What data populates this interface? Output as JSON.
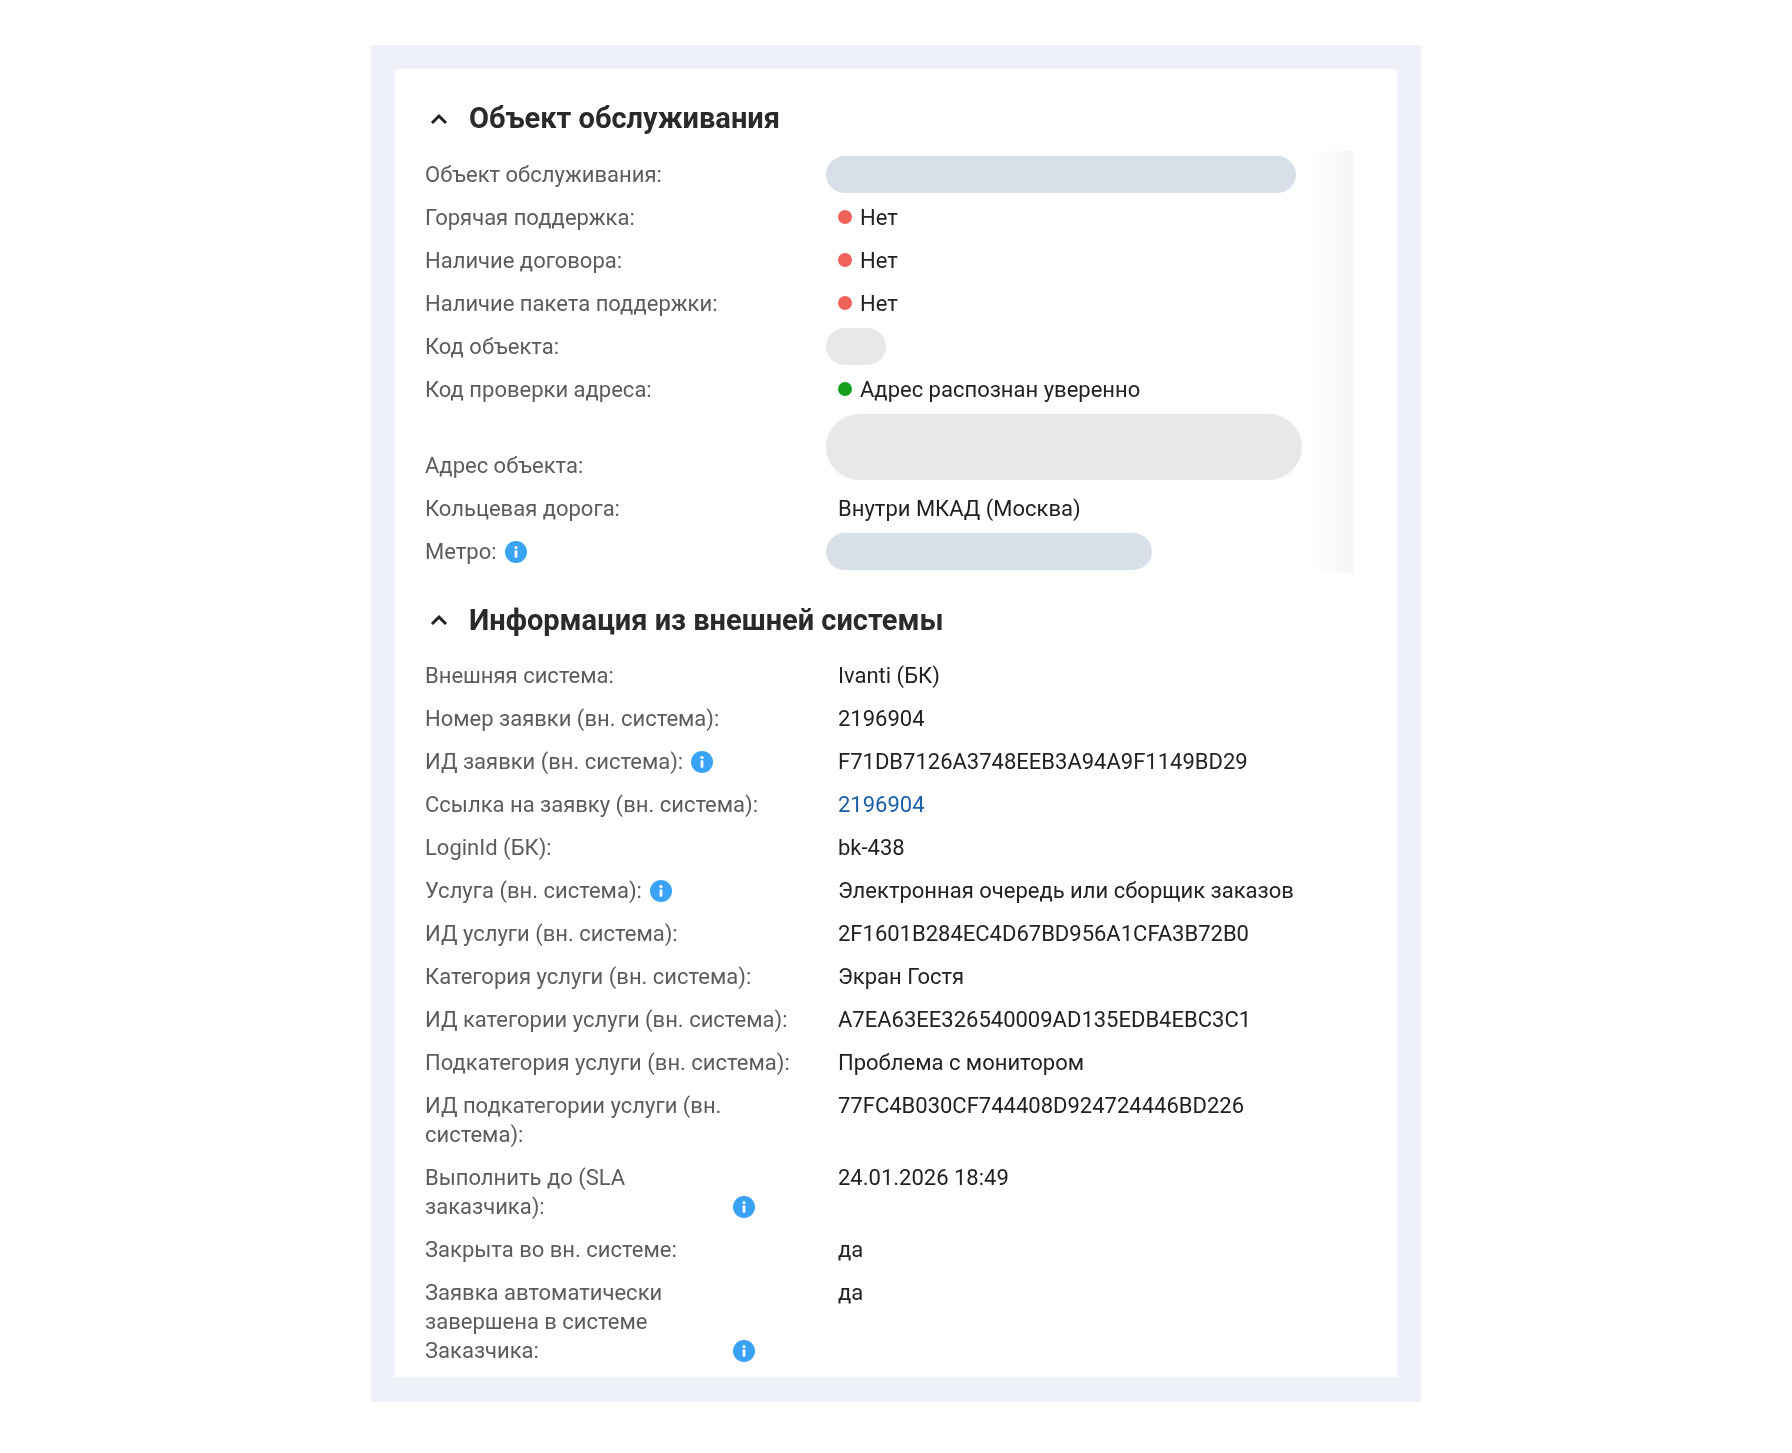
{
  "sections": [
    {
      "title": "Объект обслуживания",
      "expanded": true,
      "scroll_track": true,
      "rows": [
        {
          "label": "Объект обслуживания:",
          "value": {
            "kind": "longbar"
          }
        },
        {
          "label": "Горячая поддержка:",
          "value": {
            "kind": "status",
            "text": "Нет",
            "color": "#f0625a"
          }
        },
        {
          "label": "Наличие договора:",
          "value": {
            "kind": "status",
            "text": "Нет",
            "color": "#f0625a"
          }
        },
        {
          "label": "Наличие пакета поддержки:",
          "value": {
            "kind": "status",
            "text": "Нет",
            "color": "#f0625a"
          }
        },
        {
          "label": "Код объекта:",
          "value": {
            "kind": "chip"
          }
        },
        {
          "label": "Код проверки адреса:",
          "value": {
            "kind": "status",
            "text": "Адрес распознан уверенно",
            "color": "#16a01c"
          }
        },
        {
          "label": "Адрес объекта:",
          "value": {
            "kind": "block"
          }
        },
        {
          "label": "Кольцевая дорога:",
          "value": {
            "kind": "text",
            "text": "Внутри МКАД (Москва)"
          }
        },
        {
          "label": "Метро:",
          "info": true,
          "value": {
            "kind": "shortbar"
          }
        }
      ]
    },
    {
      "title": "Информация из внешней системы",
      "expanded": true,
      "rows": [
        {
          "label": "Внешняя система:",
          "value": {
            "kind": "text",
            "text": "Ivanti (БК)"
          }
        },
        {
          "label": "Номер заявки (вн. система):",
          "value": {
            "kind": "text",
            "text": "2196904"
          }
        },
        {
          "label": "ИД заявки (вн. система):",
          "info": true,
          "value": {
            "kind": "text",
            "text": "F71DB7126A3748EEB3A94A9F1149BD29"
          }
        },
        {
          "label": "Ссылка на заявку (вн. система):",
          "value": {
            "kind": "link",
            "text": "2196904"
          }
        },
        {
          "label": "LoginId (БК):",
          "value": {
            "kind": "text",
            "text": "bk-438"
          }
        },
        {
          "label": "Услуга (вн. система):",
          "info": true,
          "value": {
            "kind": "text",
            "text": "Электронная очередь или сборщик заказов"
          }
        },
        {
          "label": "ИД услуги (вн. система):",
          "value": {
            "kind": "text",
            "text": "2F1601B284EC4D67BD956A1CFA3B72B0"
          }
        },
        {
          "label": "Категория услуги (вн. система):",
          "value": {
            "kind": "text",
            "text": "Экран Гостя"
          }
        },
        {
          "label": "ИД категории услуги (вн. система):",
          "value": {
            "kind": "text",
            "text": "A7EA63EE326540009AD135EDB4EBC3C1"
          }
        },
        {
          "label": "Подкатегория услуги (вн. система):",
          "value": {
            "kind": "text",
            "text": "Проблема с монитором"
          }
        },
        {
          "label": "ИД подкатегории услуги (вн. система):",
          "value": {
            "kind": "text",
            "text": "77FC4B030CF744408D924724446BD226"
          }
        },
        {
          "label": "Выполнить до (SLA заказчика):",
          "info": true,
          "value": {
            "kind": "text",
            "text": "24.01.2026 18:49"
          }
        },
        {
          "label": "Закрыта во вн. системе:",
          "value": {
            "kind": "text",
            "text": "да"
          }
        },
        {
          "label": "Заявка автоматически завершена в системе Заказчика:",
          "info": true,
          "value": {
            "kind": "text",
            "text": "да"
          }
        }
      ]
    }
  ]
}
